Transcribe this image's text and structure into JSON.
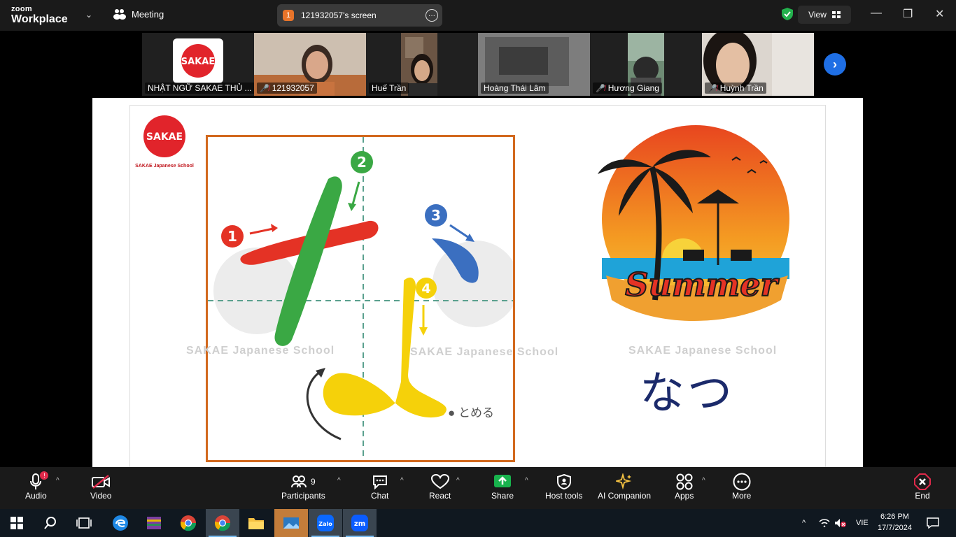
{
  "app": {
    "brand_top": "zoom",
    "brand_bottom": "Workplace",
    "meeting_label": "Meeting",
    "screen_count": "1",
    "screen_title": "121932057's screen",
    "view_label": "View"
  },
  "participants": [
    {
      "name": "NHẬT NGỮ SAKAE THỦ ...",
      "muted": false
    },
    {
      "name": "121932057",
      "muted": true
    },
    {
      "name": "Huế Trần",
      "muted": false
    },
    {
      "name": "Hoàng Thái Lâm",
      "muted": false
    },
    {
      "name": "Hương Giang",
      "muted": true
    },
    {
      "name": "Huỳnh Trần",
      "muted": true
    }
  ],
  "slide": {
    "logo_caption": "SAKAE Japanese School",
    "stroke_numbers": [
      "1",
      "2",
      "3",
      "4"
    ],
    "tomeru": "● とめる",
    "word": "なつ",
    "summer_text": "Summer",
    "watermark": "SAKAE Japanese School"
  },
  "toolbar": {
    "audio": "Audio",
    "audio_badge": "!",
    "video": "Video",
    "participants": "Participants",
    "participants_count": "9",
    "chat": "Chat",
    "react": "React",
    "share": "Share",
    "host_tools": "Host tools",
    "ai_companion": "AI Companion",
    "apps": "Apps",
    "more": "More",
    "end": "End"
  },
  "taskbar": {
    "language": "VIE",
    "time": "6:26 PM",
    "date": "17/7/2024"
  },
  "colors": {
    "accent_green": "#3ccf6a",
    "share_green": "#18b34d",
    "end_red": "#e0294a",
    "box_orange": "#d2691e"
  }
}
